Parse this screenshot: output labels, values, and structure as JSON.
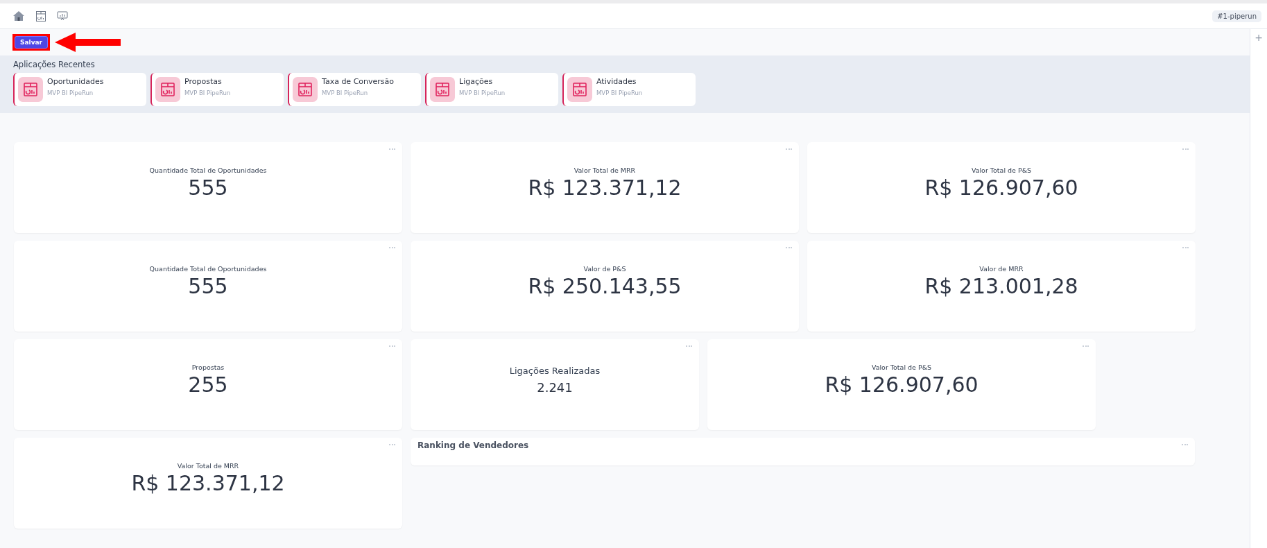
{
  "toolbar": {
    "tag": "#1-piperun"
  },
  "save_button": {
    "label": "Salvar",
    "highlighted": true
  },
  "recent_apps": {
    "title": "Aplicações Recentes",
    "items": [
      {
        "name": "Oportunidades",
        "subtitle": "MVP BI PipeRun"
      },
      {
        "name": "Propostas",
        "subtitle": "MVP BI PipeRun"
      },
      {
        "name": "Taxa de Conversão",
        "subtitle": "MVP BI PipeRun"
      },
      {
        "name": "Ligações",
        "subtitle": "MVP BI PipeRun"
      },
      {
        "name": "Atividades",
        "subtitle": "MVP BI PipeRun"
      }
    ]
  },
  "side_panel": {
    "add": "+"
  },
  "cards": [
    {
      "kind": "metric",
      "title": "Quantidade Total de Oportunidades",
      "value": "555"
    },
    {
      "kind": "metric",
      "title": "Valor Total de MRR",
      "value": "R$ 123.371,12"
    },
    {
      "kind": "metric",
      "title": "Valor Total de P&S",
      "value": "R$ 126.907,60"
    },
    {
      "kind": "metric",
      "title": "Quantidade Total de Oportunidades",
      "value": "555"
    },
    {
      "kind": "metric",
      "title": "Valor de P&S",
      "value": "R$ 250.143,55"
    },
    {
      "kind": "metric",
      "title": "Valor de MRR",
      "value": "R$ 213.001,28"
    },
    {
      "kind": "metric",
      "title": "Propostas",
      "value": "255"
    },
    {
      "kind": "compact",
      "title": "Ligações Realizadas",
      "value": "2.241"
    },
    {
      "kind": "metric",
      "title": "Valor Total de P&S",
      "value": "R$ 126.907,60"
    },
    {
      "kind": "metric",
      "title": "Valor Total de MRR",
      "value": "R$ 123.371,12"
    },
    {
      "kind": "wide",
      "title": "Ranking de Vendedores"
    }
  ]
}
